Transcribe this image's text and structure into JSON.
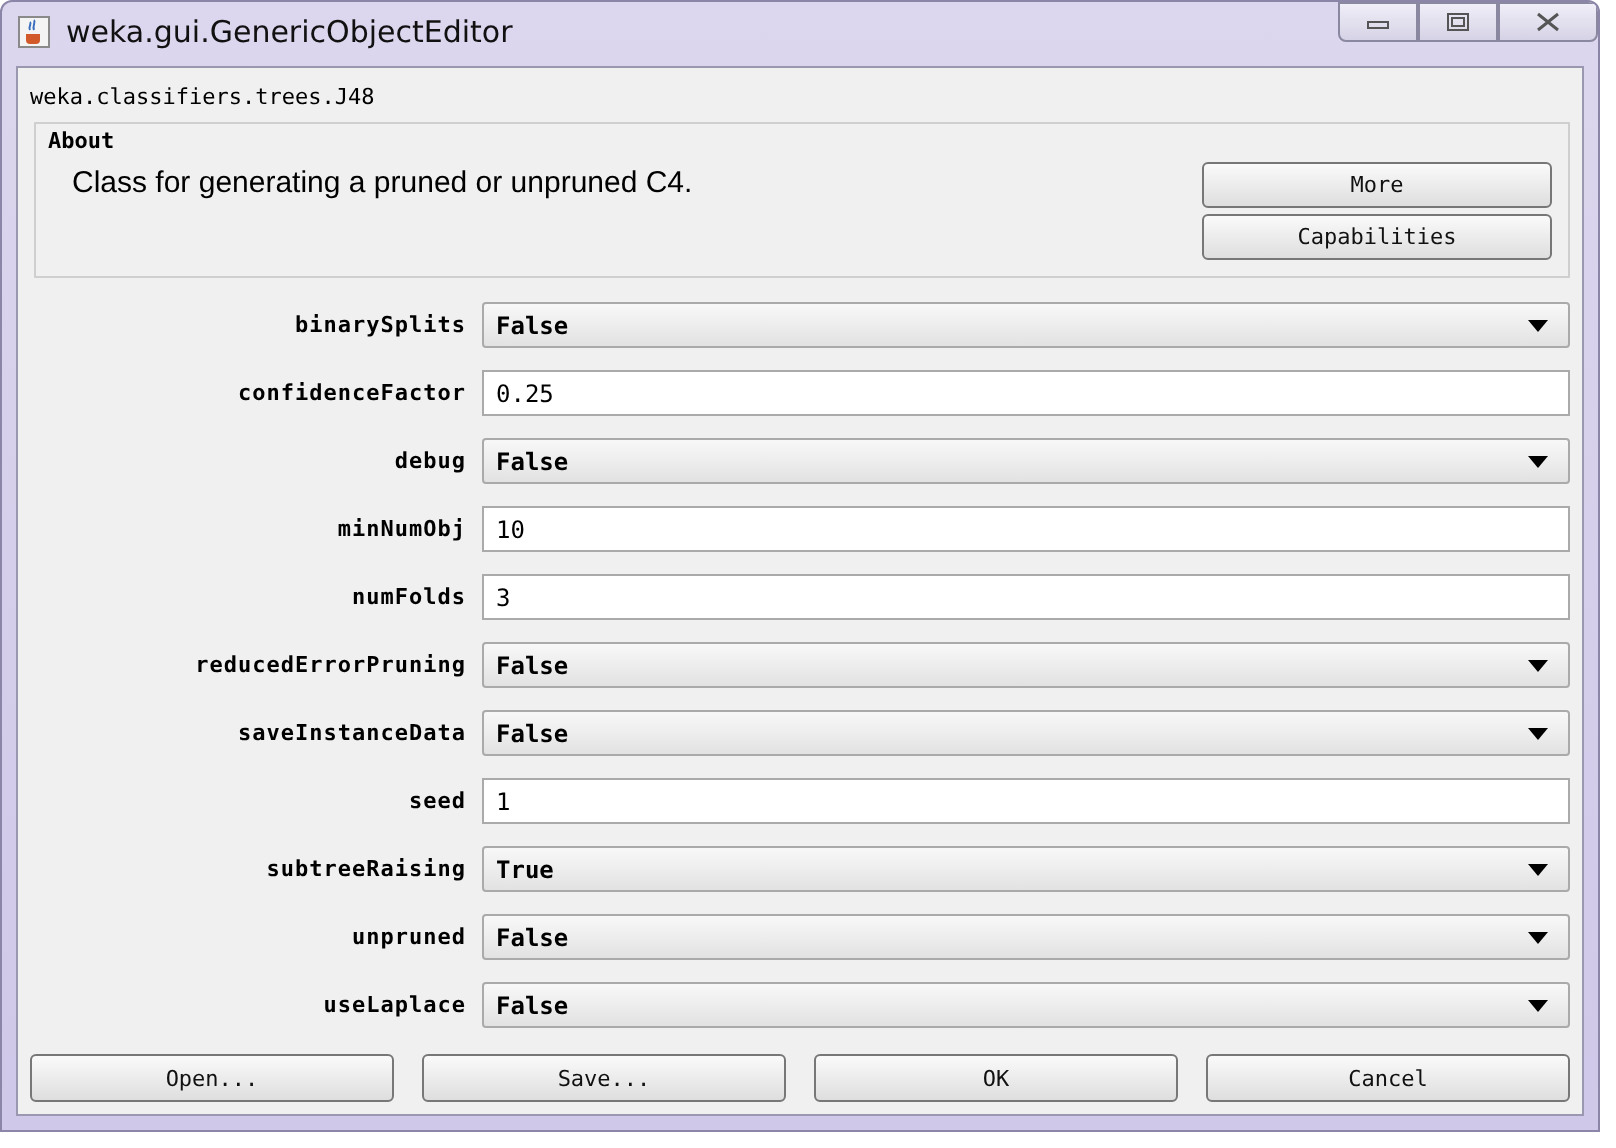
{
  "window": {
    "title": "weka.gui.GenericObjectEditor"
  },
  "class_name": "weka.classifiers.trees.J48",
  "about": {
    "heading": "About",
    "text": "Class for generating a pruned or unpruned C4.",
    "buttons": [
      "More",
      "Capabilities"
    ]
  },
  "properties": [
    {
      "name": "binarySplits",
      "kind": "choice",
      "value": "False"
    },
    {
      "name": "confidenceFactor",
      "kind": "text",
      "value": "0.25"
    },
    {
      "name": "debug",
      "kind": "choice",
      "value": "False"
    },
    {
      "name": "minNumObj",
      "kind": "text",
      "value": "10"
    },
    {
      "name": "numFolds",
      "kind": "text",
      "value": "3"
    },
    {
      "name": "reducedErrorPruning",
      "kind": "choice",
      "value": "False"
    },
    {
      "name": "saveInstanceData",
      "kind": "choice",
      "value": "False"
    },
    {
      "name": "seed",
      "kind": "text",
      "value": "1"
    },
    {
      "name": "subtreeRaising",
      "kind": "choice",
      "value": "True"
    },
    {
      "name": "unpruned",
      "kind": "choice",
      "value": "False"
    },
    {
      "name": "useLaplace",
      "kind": "choice",
      "value": "False"
    }
  ],
  "buttons": [
    "Open...",
    "Save...",
    "OK",
    "Cancel"
  ]
}
